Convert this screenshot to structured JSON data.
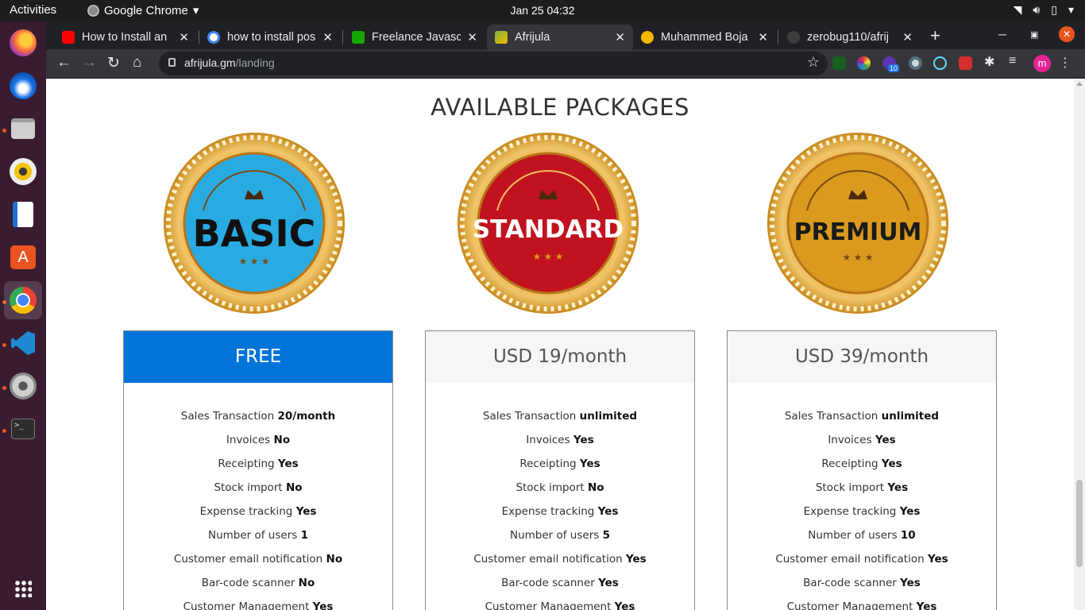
{
  "system": {
    "activities": "Activities",
    "app_name": "Google Chrome",
    "clock": "Jan 25  04:32"
  },
  "browser": {
    "tabs": [
      {
        "title": "How to Install an",
        "favicon_color": "#ff0000",
        "icon": "youtube-icon"
      },
      {
        "title": "how to install pos",
        "favicon_color": "#4285f4",
        "icon": "google-icon"
      },
      {
        "title": "Freelance Javascr",
        "favicon_color": "#14a800",
        "icon": "upwork-icon"
      },
      {
        "title": "Afrijula",
        "favicon_color": "#7cb342",
        "icon": "afrijula-icon",
        "active": true
      },
      {
        "title": "Muhammed Boja",
        "favicon_color": "#f5b800",
        "icon": "medium-icon"
      },
      {
        "title": "zerobug110/afrij",
        "favicon_color": "#5f6368",
        "icon": "github-icon"
      }
    ],
    "url_host": "afrijula.gm",
    "url_path": "/landing",
    "extension_badge": "10",
    "profile_initial": "m"
  },
  "page": {
    "title": "AVAILABLE PACKAGES",
    "packages": [
      {
        "badge_text": "BASIC",
        "price": "FREE",
        "features": [
          {
            "label": "Sales Transaction",
            "value": "20/month"
          },
          {
            "label": "Invoices",
            "value": "No"
          },
          {
            "label": "Receipting",
            "value": "Yes"
          },
          {
            "label": "Stock import",
            "value": "No"
          },
          {
            "label": "Expense tracking",
            "value": "Yes"
          },
          {
            "label": "Number of users",
            "value": "1"
          },
          {
            "label": "Customer email notification",
            "value": "No"
          },
          {
            "label": "Bar-code scanner",
            "value": "No"
          },
          {
            "label": "Customer Management",
            "value": "Yes"
          }
        ]
      },
      {
        "badge_text": "STANDARD",
        "price": "USD 19/month",
        "features": [
          {
            "label": "Sales Transaction",
            "value": "unlimited"
          },
          {
            "label": "Invoices",
            "value": "Yes"
          },
          {
            "label": "Receipting",
            "value": "Yes"
          },
          {
            "label": "Stock import",
            "value": "No"
          },
          {
            "label": "Expense tracking",
            "value": "Yes"
          },
          {
            "label": "Number of users",
            "value": "5"
          },
          {
            "label": "Customer email notification",
            "value": "Yes"
          },
          {
            "label": "Bar-code scanner",
            "value": "Yes"
          },
          {
            "label": "Customer Management",
            "value": "Yes"
          }
        ]
      },
      {
        "badge_text": "PREMIUM",
        "price": "USD 39/month",
        "features": [
          {
            "label": "Sales Transaction",
            "value": "unlimited"
          },
          {
            "label": "Invoices",
            "value": "Yes"
          },
          {
            "label": "Receipting",
            "value": "Yes"
          },
          {
            "label": "Stock import",
            "value": "Yes"
          },
          {
            "label": "Expense tracking",
            "value": "Yes"
          },
          {
            "label": "Number of users",
            "value": "10"
          },
          {
            "label": "Customer email notification",
            "value": "Yes"
          },
          {
            "label": "Bar-code scanner",
            "value": "Yes"
          },
          {
            "label": "Customer Management",
            "value": "Yes"
          }
        ]
      }
    ]
  },
  "colors": {
    "basic_badge": "#29abe2",
    "standard_badge": "#c1121f",
    "premium_badge": "#d99a1e",
    "free_header": "#0074d9"
  }
}
